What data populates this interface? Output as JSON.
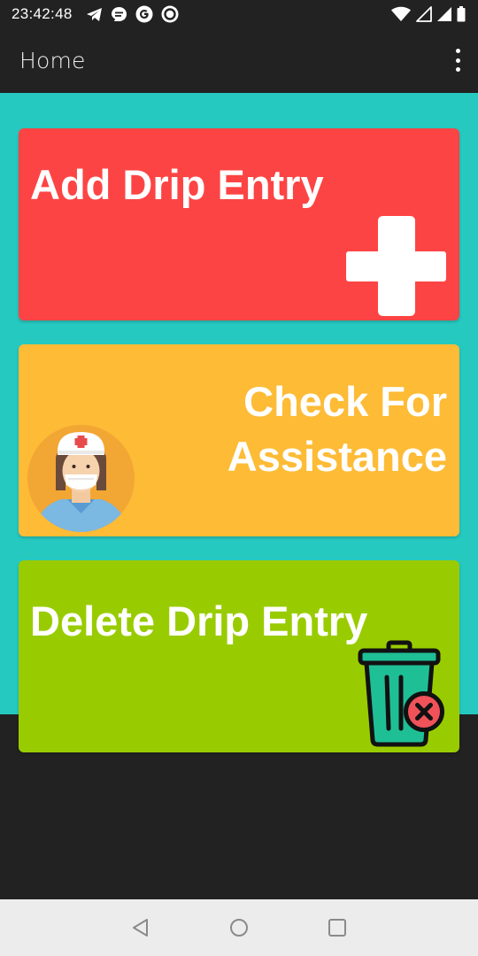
{
  "status_bar": {
    "time": "23:42:48",
    "left_icons": [
      "telegram-icon",
      "chat-bubble-icon",
      "google-icon",
      "ring-icon"
    ],
    "right_icons": [
      "wifi-icon",
      "signal-empty-icon",
      "signal-full-icon",
      "battery-icon"
    ]
  },
  "app_bar": {
    "title": "Home",
    "menu_icon": "more-vert-icon"
  },
  "cards": {
    "add": {
      "label": "Add Drip Entry",
      "icon": "plus-icon",
      "color": "#fd4444"
    },
    "assist": {
      "line1": "Check For",
      "line2": "Assistance",
      "icon": "nurse-icon",
      "color": "#fdbb36"
    },
    "delete": {
      "label": "Delete Drip Entry",
      "icon": "trash-icon",
      "color": "#99cc00"
    }
  },
  "colors": {
    "panel": "#26c9c0",
    "background": "#222222",
    "nav_bar": "#ececec"
  },
  "nav_bar": {
    "buttons": [
      "back-icon",
      "home-icon",
      "recents-icon"
    ]
  }
}
